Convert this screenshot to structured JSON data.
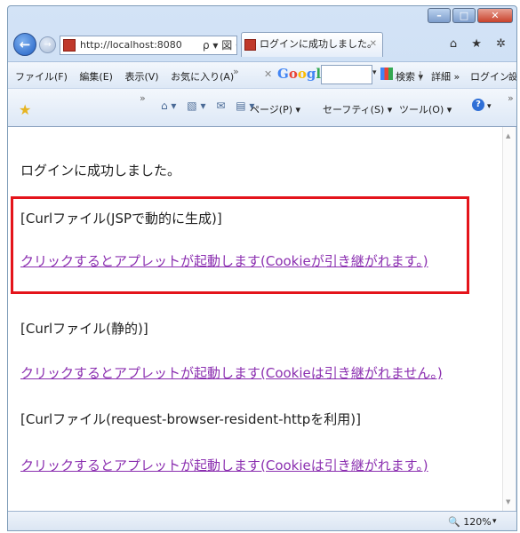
{
  "window": {
    "minimize": "–",
    "maximize": "□",
    "close": "✕"
  },
  "nav": {
    "back": "←",
    "forward": "→",
    "address": "http://localhost:8080",
    "address_controls": "ρ ▾ 図 C ✕",
    "tab_title": "ログインに成功しました。",
    "tab_close": "✕",
    "right_icons": "⌂ ★ ✲"
  },
  "menubar": {
    "items": [
      "ファイル(F)",
      "編集(E)",
      "表示(V)",
      "お気に入り(A)"
    ],
    "more": "»"
  },
  "google_toolbar": {
    "close": "✕",
    "logo": "Google",
    "dropdown": "▾",
    "search_label": "検索 ▾",
    "separator": "|",
    "details": "詳細 »",
    "login": "ログイン",
    "extra": "設"
  },
  "commandbar": {
    "star": "★",
    "more": "»",
    "icons": [
      "⌂ ▾",
      "▧ ▾",
      "✉",
      "▤ ▾"
    ],
    "page": "ページ(P) ▾",
    "safety": "セーフティ(S) ▾",
    "tools": "ツール(O) ▾",
    "help": "?",
    "help_dd": "▾",
    "more_right": "»"
  },
  "content": {
    "message": "ログインに成功しました。",
    "section1_title": "[Curlファイル(JSPで動的に生成)]",
    "section1_link": "クリックするとアプレットが起動します(Cookieが引き継がれます。)",
    "section2_title": "[Curlファイル(静的)]",
    "section2_link": "クリックするとアプレットが起動します(Cookieは引き継がれません。)",
    "section3_title": "[Curlファイル(request-browser-resident-httpを利用)]",
    "section3_link": "クリックするとアプレットが起動します(Cookieは引き継がれます。)"
  },
  "statusbar": {
    "zoom_icon": "🔍",
    "zoom": "120%",
    "zoom_dd": "▾"
  },
  "colors": {
    "link": "#8b2fb0",
    "highlight_box": "#e4141b"
  }
}
